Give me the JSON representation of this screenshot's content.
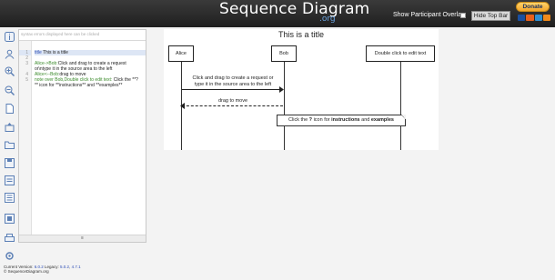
{
  "header": {
    "logo": "Sequence Diagram",
    "logo_suffix": ".org",
    "overlay_label": "Show Participant Overlay",
    "hide_button": "Hide Top Bar",
    "donate_button": "Donate",
    "payment_icons": [
      "visa",
      "mastercard",
      "amex",
      "discover"
    ],
    "colors": {
      "bar": "#262626",
      "org": "#6aa3e0",
      "donate": "#f4a52a"
    }
  },
  "toolbar": [
    {
      "icon": "info-icon"
    },
    {
      "icon": "user-icon"
    },
    {
      "icon": "zoom-in-icon"
    },
    {
      "icon": "zoom-out-icon"
    },
    {
      "icon": "document-icon"
    },
    {
      "icon": "upload-icon"
    },
    {
      "icon": "download-icon"
    },
    {
      "icon": "folder-icon"
    },
    {
      "icon": "save-icon"
    },
    {
      "icon": "save-as-icon"
    },
    {
      "icon": "list-icon"
    },
    {
      "icon": "export-icon"
    },
    {
      "icon": "print-icon"
    },
    {
      "icon": "settings-icon"
    }
  ],
  "editor": {
    "header_text": "syntax errors displayed here can be clicked",
    "line_numbers": [
      "1",
      "2",
      "3",
      "4",
      "5",
      "6"
    ],
    "lines": [
      {
        "kw": "title",
        "rest": " This is a title",
        "cls": "k"
      },
      {
        "kw": "",
        "rest": "",
        "cls": "t"
      },
      {
        "kw": "Alice->Bob:",
        "rest": "Click and drag to create a request",
        "cls": "g"
      },
      {
        "kw": "",
        "rest": "or\\ntype it in the source area to the left",
        "cls": "t"
      },
      {
        "kw": "Alice<--Bob:",
        "rest": "drag to move",
        "cls": "g"
      },
      {
        "kw": "note over Bob,Double click to edit text:",
        "rest": " Click the **?",
        "cls": "g"
      },
      {
        "kw": "",
        "rest": "** icon for **instructions** and **examples**",
        "cls": "t"
      }
    ],
    "footer_handle": "≡"
  },
  "diagram": {
    "title": "This is a title",
    "participants": [
      "Alice",
      "Bob",
      "Double click to edit text"
    ],
    "message1_line1": "Click and drag to create a request or",
    "message1_line2": "type it in the source area to the left",
    "message2": "drag to move",
    "note_prefix": "Click the ",
    "note_q": "?",
    "note_mid": " icon for ",
    "note_instructions": "instructions",
    "note_and": " and ",
    "note_examples": "examples"
  },
  "footer": {
    "version_label": "Current Version: ",
    "version": "6.0.2",
    "legacy_label": " Legacy: ",
    "legacy1": "5.0.2",
    "legacy2": "4.7.1",
    "copyright": "© SequenceDiagram.org"
  }
}
